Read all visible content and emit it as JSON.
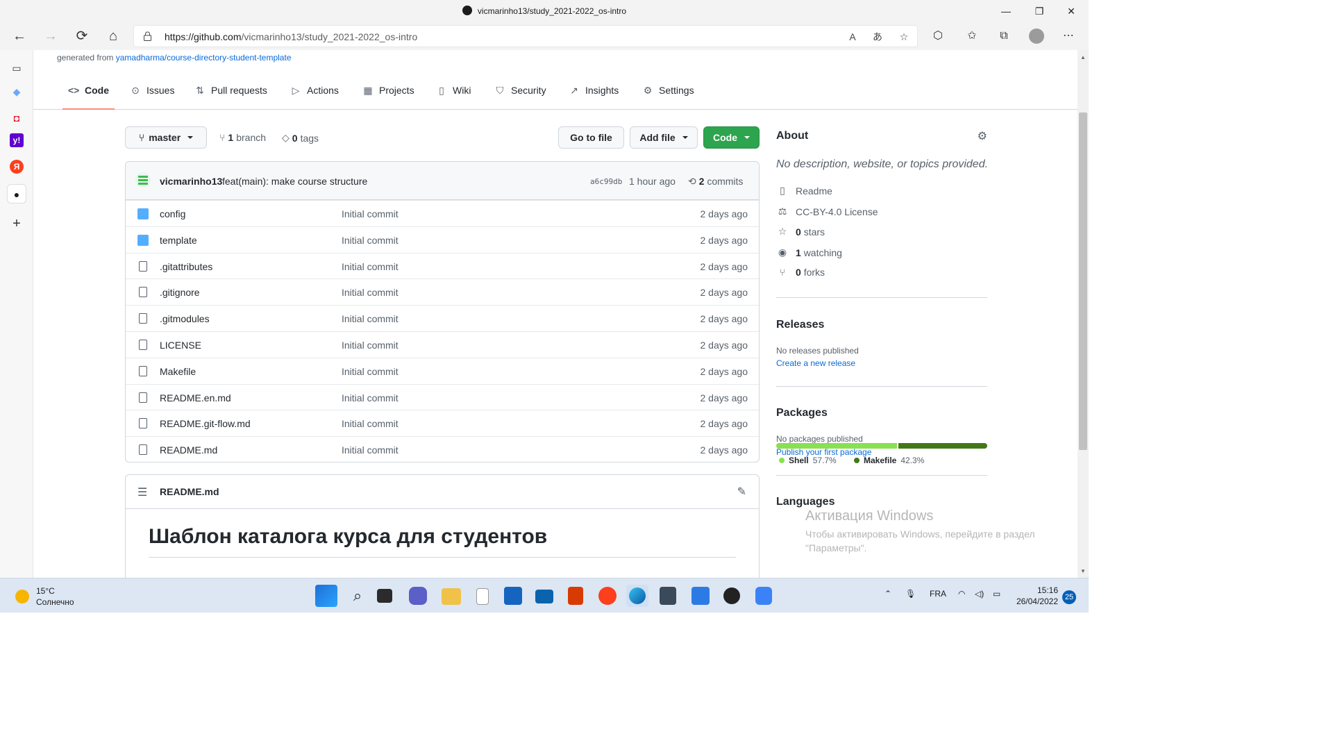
{
  "window": {
    "title": "vicmarinho13/study_2021-2022_os-intro",
    "minimize": "—",
    "maximize": "❐",
    "close": "✕"
  },
  "addressbar": {
    "url_host": "https://github.com",
    "url_path": "/vicmarinho13/study_2021-2022_os-intro",
    "back": "←",
    "forward": "→",
    "refresh": "⟳",
    "home": "⌂"
  },
  "page": {
    "generated_prefix": "generated from ",
    "generated_link": "yamadharma/course-directory-student-template",
    "tabs": [
      {
        "label": "Code",
        "icon": "<>"
      },
      {
        "label": "Issues",
        "icon": "⊙"
      },
      {
        "label": "Pull requests",
        "icon": "⇅"
      },
      {
        "label": "Actions",
        "icon": "▷"
      },
      {
        "label": "Projects",
        "icon": "▦"
      },
      {
        "label": "Wiki",
        "icon": "📖"
      },
      {
        "label": "Security",
        "icon": "⛉"
      },
      {
        "label": "Insights",
        "icon": "↗"
      },
      {
        "label": "Settings",
        "icon": "⚙"
      }
    ],
    "branch_button": "master",
    "branches_count": "1",
    "branches_label": "branch",
    "tags_count": "0",
    "tags_label": "tags",
    "go_to_file": "Go to file",
    "add_file": "Add file",
    "code_button": "Code"
  },
  "commit": {
    "user": "vicmarinho13",
    "message": "feat(main): make course structure",
    "sha": "a6c99db",
    "time": "1 hour ago",
    "commits_count": "2",
    "commits_label": "commits"
  },
  "files": [
    {
      "name": "config",
      "type": "folder",
      "message": "Initial commit",
      "age": "2 days ago"
    },
    {
      "name": "template",
      "type": "folder",
      "message": "Initial commit",
      "age": "2 days ago"
    },
    {
      "name": ".gitattributes",
      "type": "file",
      "message": "Initial commit",
      "age": "2 days ago"
    },
    {
      "name": ".gitignore",
      "type": "file",
      "message": "Initial commit",
      "age": "2 days ago"
    },
    {
      "name": ".gitmodules",
      "type": "file",
      "message": "Initial commit",
      "age": "2 days ago"
    },
    {
      "name": "LICENSE",
      "type": "file",
      "message": "Initial commit",
      "age": "2 days ago"
    },
    {
      "name": "Makefile",
      "type": "file",
      "message": "Initial commit",
      "age": "2 days ago"
    },
    {
      "name": "README.en.md",
      "type": "file",
      "message": "Initial commit",
      "age": "2 days ago"
    },
    {
      "name": "README.git-flow.md",
      "type": "file",
      "message": "Initial commit",
      "age": "2 days ago"
    },
    {
      "name": "README.md",
      "type": "file",
      "message": "Initial commit",
      "age": "2 days ago"
    }
  ],
  "readme": {
    "filename": "README.md",
    "heading": "Шаблон каталога курса для студентов"
  },
  "about": {
    "title": "About",
    "description": "No description, website, or topics provided.",
    "readme": "Readme",
    "license": "CC-BY-4.0 License",
    "stars_count": "0",
    "stars_label": "stars",
    "watching_count": "1",
    "watching_label": "watching",
    "forks_count": "0",
    "forks_label": "forks",
    "releases_title": "Releases",
    "releases_none": "No releases published",
    "releases_link": "Create a new release",
    "packages_title": "Packages",
    "packages_none": "No packages published",
    "packages_link": "Publish your first package",
    "languages_title": "Languages",
    "languages": [
      {
        "name": "Shell",
        "percent": "57.7%",
        "value": 57.7,
        "color": "#89e051"
      },
      {
        "name": "Makefile",
        "percent": "42.3%",
        "value": 42.3,
        "color": "#427819"
      }
    ]
  },
  "watermark": {
    "line1": "Активация Windows",
    "line2": "Чтобы активировать Windows, перейдите в раздел \"Параметры\"."
  },
  "taskbar": {
    "temperature": "15°C",
    "weather": "Солнечно",
    "lang": "FRA",
    "time": "15:16",
    "date": "26/04/2022",
    "notifications": "25"
  },
  "colors": {
    "accent": "#0969da",
    "green_button": "#2da44e",
    "tab_underline": "#fd8c73",
    "folder": "#54aeff"
  }
}
